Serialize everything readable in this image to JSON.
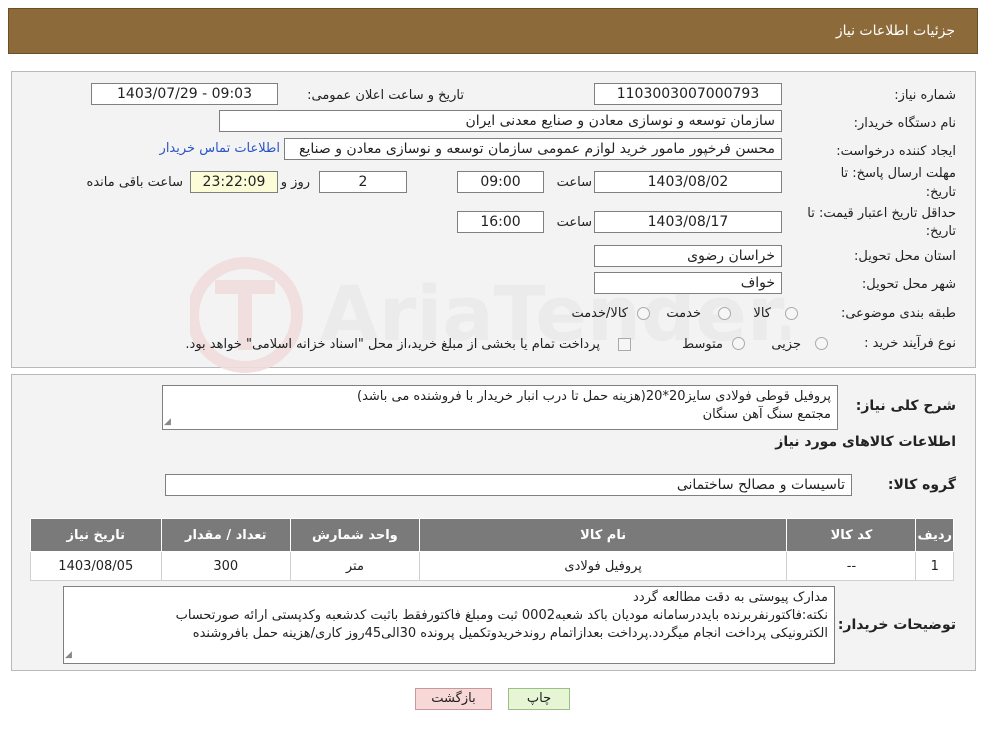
{
  "header": {
    "title": "جزئیات اطلاعات نیاز"
  },
  "form": {
    "need_number_label": "شماره نیاز:",
    "need_number": "1103003007000793",
    "announce_label": "تاریخ و ساعت اعلان عمومی:",
    "announce_value": "1403/07/29 - 09:03",
    "buyer_org_label": "نام دستگاه خریدار:",
    "buyer_org": "سازمان توسعه و نوسازی معادن و صنایع معدنی ایران",
    "creator_label": "ایجاد کننده درخواست:",
    "creator": "محسن فرخپور مامور خرید لوازم عمومی سازمان توسعه و نوسازی معادن و صنایع",
    "contact_link": "اطلاعات تماس خریدار",
    "deadline_label_1": "مهلت ارسال پاسخ: تا",
    "deadline_label_2": "تاریخ:",
    "deadline_date": "1403/08/02",
    "time_word": "ساعت",
    "deadline_time": "09:00",
    "days_value": "2",
    "days_word": "روز و",
    "remaining_time": "23:22:09",
    "remaining_word": "ساعت باقی مانده",
    "validity_label_1": "حداقل تاریخ اعتبار قیمت: تا",
    "validity_label_2": "تاریخ:",
    "validity_date": "1403/08/17",
    "validity_time": "16:00",
    "province_label": "استان محل تحویل:",
    "province": "خراسان رضوی",
    "city_label": "شهر محل تحویل:",
    "city": "خواف",
    "category_label": "طبقه بندی موضوعی:",
    "category_options": [
      "کالا",
      "خدمت",
      "کالا/خدمت"
    ],
    "process_label": "نوع فرآیند خرید :",
    "process_options": [
      "جزیی",
      "متوسط"
    ],
    "process_note": "پرداخت تمام یا بخشی از مبلغ خرید،از محل \"اسناد خزانه اسلامی\" خواهد بود."
  },
  "summary": {
    "label": "شرح کلی نیاز:",
    "line1": "پروفیل قوطی فولادی سایز20*20(هزینه حمل تا درب انبار خریدار با فروشنده می باشد)",
    "line2": "مجتمع سنگ آهن سنگان",
    "goods_info_title": "اطلاعات کالاهای مورد نیاز",
    "goods_group_label": "گروه کالا:",
    "goods_group": "تاسیسات و مصالح ساختمانی"
  },
  "table": {
    "headers": [
      "ردیف",
      "کد کالا",
      "نام کالا",
      "واحد شمارش",
      "تعداد / مقدار",
      "تاریخ نیاز"
    ],
    "rows": [
      [
        "1",
        "--",
        "پروفیل فولادی",
        "متر",
        "300",
        "1403/08/05"
      ]
    ]
  },
  "buyer_notes": {
    "label": "توضیحات خریدار:",
    "line1": "مدارک پیوستی به دقت مطالعه گردد",
    "line2": "نکته:فاکتورنفربرنده بایددرسامانه مودیان باکد شعبه0002 ثبت ومبلغ فاکتورفقط باثبت کدشعبه وکدپستی ارائه صورتحساب",
    "line3": "الکترونیکی پرداخت انجام میگردد.پرداخت بعدازاتمام روندخریدوتکمیل پرونده 30الی45روز کاری/هزینه حمل بافروشنده"
  },
  "buttons": {
    "print": "چاپ",
    "back": "بازگشت"
  },
  "colors": {
    "header_bg": "#8c6a3a",
    "link": "#2a55c8",
    "print_button_bg": "#e6f5d4",
    "back_button_bg": "#f8d7d7",
    "table_header_bg": "#7a7a7a"
  },
  "watermark": {
    "text": "AriaTender.neT"
  }
}
